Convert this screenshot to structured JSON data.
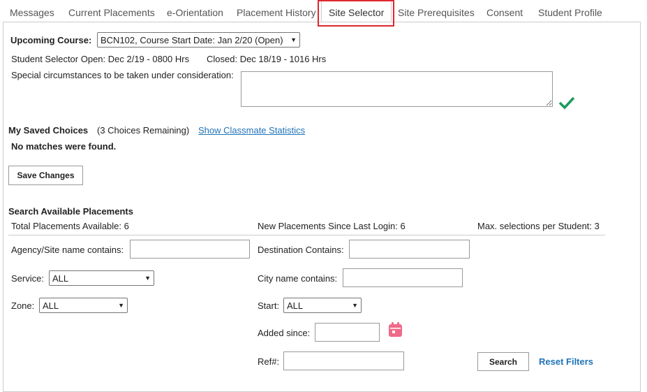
{
  "tabs": [
    {
      "label": "Messages"
    },
    {
      "label": "Current Placements"
    },
    {
      "label": "e-Orientation"
    },
    {
      "label": "Placement History"
    },
    {
      "label": "Site Selector",
      "active": true
    },
    {
      "label": "Site Prerequisites"
    },
    {
      "label": "Consent"
    },
    {
      "label": "Student Profile"
    }
  ],
  "course": {
    "label": "Upcoming Course:",
    "selected": "BCN102, Course Start Date: Jan 2/20 (Open)",
    "selector_open": "Student Selector Open: Dec 2/19 - 0800 Hrs",
    "selector_closed": "Closed: Dec 18/19 - 1016 Hrs",
    "special_label": "Special circumstances to be taken under consideration:",
    "special_value": ""
  },
  "saved": {
    "title": "My Saved Choices",
    "remaining": "(3 Choices Remaining)",
    "stats_link": "Show Classmate Statistics",
    "empty": "No matches were found.",
    "save_button": "Save Changes"
  },
  "search": {
    "title": "Search Available Placements",
    "total": "Total Placements Available: 6",
    "new_since": "New Placements Since Last Login: 6",
    "max": "Max. selections per Student: 3",
    "agency_label": "Agency/Site name contains:",
    "destination_label": "Destination Contains:",
    "service_label": "Service:",
    "service_value": "ALL",
    "city_label": "City name contains:",
    "zone_label": "Zone:",
    "zone_value": "ALL",
    "start_label": "Start:",
    "start_value": "ALL",
    "added_label": "Added since:",
    "ref_label": "Ref#:",
    "search_button": "Search",
    "reset_link": "Reset Filters"
  },
  "colors": {
    "accent": "#1f73b7",
    "highlight": "#e0262e",
    "check": "#1a9a5a",
    "calendar": "#f06a8a"
  }
}
